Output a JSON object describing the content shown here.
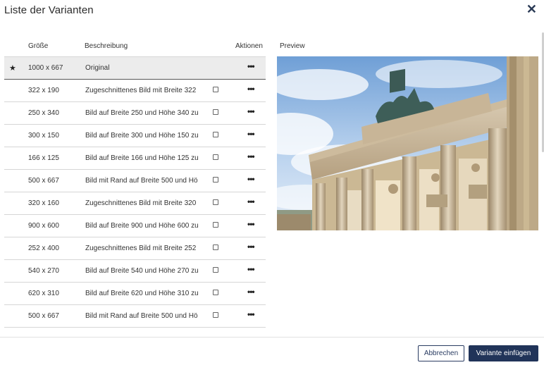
{
  "dialog": {
    "title": "Liste der Varianten",
    "close_icon": "close-icon"
  },
  "table": {
    "headers": {
      "size": "Größe",
      "description": "Beschreibung",
      "actions": "Aktionen"
    },
    "rows": [
      {
        "size": "1000 x 667",
        "description": "Original",
        "starred": true,
        "has_checkbox": false,
        "selected": true
      },
      {
        "size": "322 x 190",
        "description": "Zugeschnittenes Bild mit Breite 322",
        "starred": false,
        "has_checkbox": true,
        "selected": false
      },
      {
        "size": "250 x 340",
        "description": "Bild auf Breite 250 und Höhe 340 zu",
        "starred": false,
        "has_checkbox": true,
        "selected": false
      },
      {
        "size": "300 x 150",
        "description": "Bild auf Breite 300 und Höhe 150 zu",
        "starred": false,
        "has_checkbox": true,
        "selected": false
      },
      {
        "size": "166 x 125",
        "description": "Bild auf Breite 166 und Höhe 125 zu",
        "starred": false,
        "has_checkbox": true,
        "selected": false
      },
      {
        "size": "500 x 667",
        "description": "Bild mit Rand auf Breite 500 und Hö",
        "starred": false,
        "has_checkbox": true,
        "selected": false
      },
      {
        "size": "320 x 160",
        "description": "Zugeschnittenes Bild mit Breite 320",
        "starred": false,
        "has_checkbox": true,
        "selected": false
      },
      {
        "size": "900 x 600",
        "description": "Bild auf Breite 900 und Höhe 600 zu",
        "starred": false,
        "has_checkbox": true,
        "selected": false
      },
      {
        "size": "252 x 400",
        "description": "Zugeschnittenes Bild mit Breite 252",
        "starred": false,
        "has_checkbox": true,
        "selected": false
      },
      {
        "size": "540 x 270",
        "description": "Bild auf Breite 540 und Höhe 270 zu",
        "starred": false,
        "has_checkbox": true,
        "selected": false
      },
      {
        "size": "620 x 310",
        "description": "Bild auf Breite 620 und Höhe 310 zu",
        "starred": false,
        "has_checkbox": true,
        "selected": false
      },
      {
        "size": "500 x 667",
        "description": "Bild mit Rand auf Breite 500 und Hö",
        "starred": false,
        "has_checkbox": true,
        "selected": false
      }
    ]
  },
  "preview": {
    "label": "Preview"
  },
  "footer": {
    "cancel_label": "Abbrechen",
    "insert_label": "Variante einfügen"
  },
  "colors": {
    "primary": "#213459",
    "selected_row": "#ececec"
  }
}
